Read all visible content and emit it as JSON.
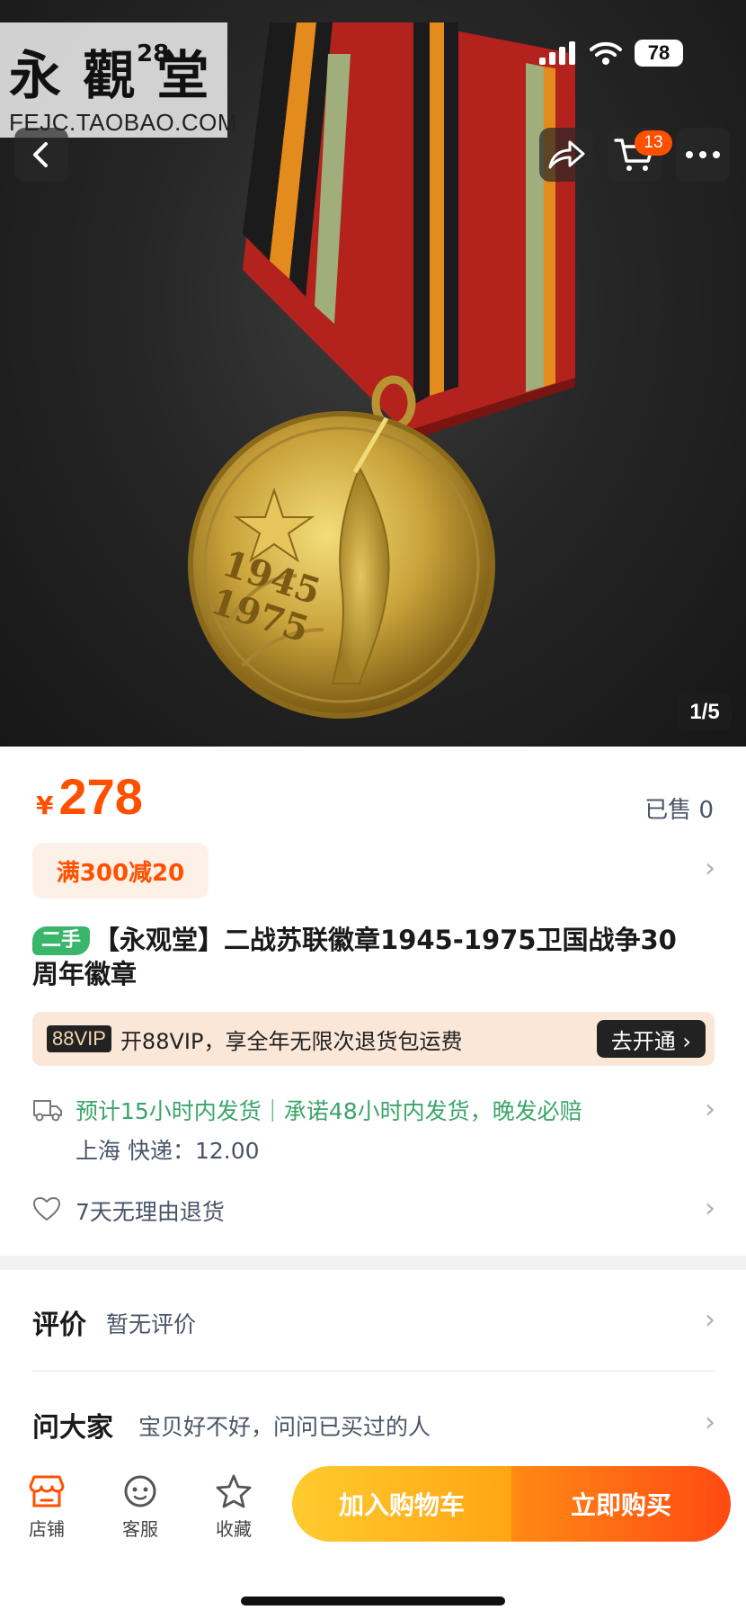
{
  "watermark": {
    "brand": "永 觀 堂",
    "number": "28",
    "url": "FEJC.TAOBAO.COM"
  },
  "status_bar": {
    "battery": "78"
  },
  "hero": {
    "image_counter": "1/5",
    "cart_badge": "13",
    "medal_years_top": "1945",
    "medal_years_bottom": "1975"
  },
  "price": {
    "currency": "¥",
    "amount": "278",
    "sold": "已售 0"
  },
  "promo": {
    "label": "满300减20"
  },
  "product": {
    "tag": "二手",
    "title": "【永观堂】二战苏联徽章1945-1975卫国战争30周年徽章"
  },
  "vip": {
    "logo": "88VIP",
    "text": "开88VIP，享全年无限次退货包运费",
    "button": "去开通 ›"
  },
  "shipping": {
    "line1": "预计15小时内发货｜承诺48小时内发货，晚发必赔",
    "line2": "上海  快递：12.00"
  },
  "returns": {
    "text": "7天无理由退货"
  },
  "reviews": {
    "label": "评价",
    "value": "暂无评价"
  },
  "ask": {
    "label": "问大家",
    "value": "宝贝好不好，问问已买过的人"
  },
  "bottom_nav": {
    "shop": "店铺",
    "service": "客服",
    "favorite": "收藏",
    "add_to_cart": "加入购物车",
    "buy_now": "立即购买"
  },
  "colors": {
    "accent": "#ff5000",
    "green": "#3ab66a",
    "cart_gradient": "#ffcb2f",
    "buy_gradient": "#ff4a14"
  },
  "icons": [
    "back-icon",
    "share-icon",
    "cart-icon",
    "more-icon",
    "truck-icon",
    "heart-icon",
    "shop-icon",
    "service-icon",
    "star-icon",
    "chevron-right-icon"
  ]
}
